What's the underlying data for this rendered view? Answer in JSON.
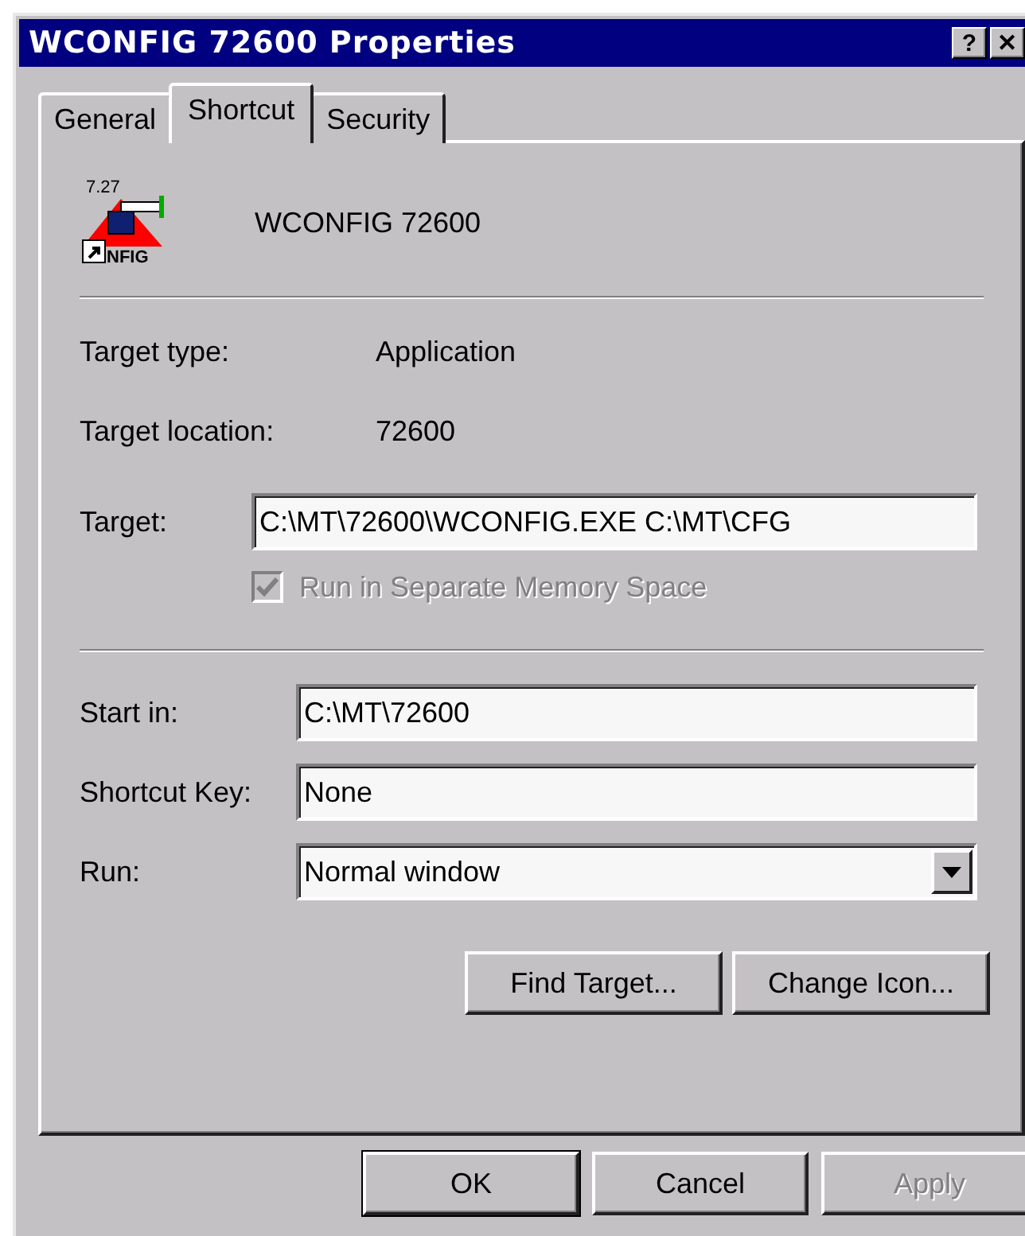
{
  "window": {
    "title": "WCONFIG 72600 Properties",
    "title_buttons": [
      "?",
      "✕"
    ]
  },
  "tabs": [
    {
      "label": "General",
      "selected": false
    },
    {
      "label": "Shortcut",
      "selected": true
    },
    {
      "label": "Security",
      "selected": false
    }
  ],
  "header": {
    "name": "WCONFIG 72600",
    "icon_texts": [
      "7.27",
      "NFIG"
    ]
  },
  "info": [
    {
      "label": "Target type:",
      "value": "Application"
    },
    {
      "label": "Target location:",
      "value": "72600"
    }
  ],
  "target": {
    "label": "Target:",
    "value": "C:\\MT\\72600\\WCONFIG.EXE C:\\MT\\CFG"
  },
  "checkbox": {
    "label": "Run in Separate Memory Space",
    "checked": true,
    "disabled": true
  },
  "settings": [
    {
      "kind": "text",
      "label": "Start in:",
      "value": "C:\\MT\\72600"
    },
    {
      "kind": "text",
      "label": "Shortcut Key:",
      "value": "None"
    },
    {
      "kind": "dropdown",
      "label": "Run:",
      "value": "Normal window"
    }
  ],
  "actions": [
    {
      "label": "Find Target..."
    },
    {
      "label": "Change Icon..."
    }
  ],
  "buttons": [
    {
      "label": "OK",
      "default": true,
      "disabled": false
    },
    {
      "label": "Cancel",
      "default": false,
      "disabled": false
    },
    {
      "label": "Apply",
      "default": false,
      "disabled": true
    }
  ]
}
